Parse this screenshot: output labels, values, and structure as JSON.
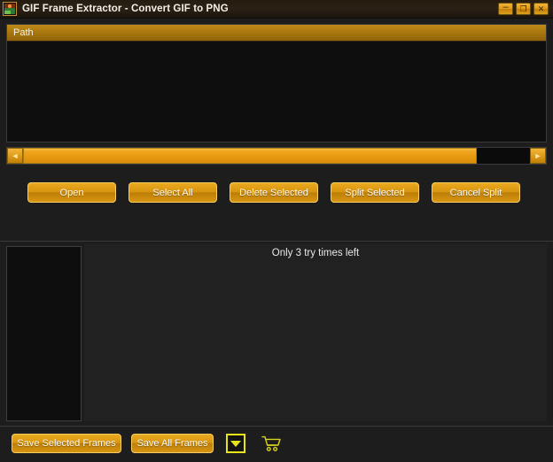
{
  "window": {
    "title": "GIF Frame Extractor - Convert GIF to PNG",
    "icon": "picture-icon",
    "controls": {
      "minimize": "–",
      "minimize_name": "minimize-button",
      "maximize": "❐",
      "maximize_name": "maximize-button",
      "close": "✕",
      "close_name": "close-button"
    }
  },
  "file_list": {
    "columns": [
      "Path"
    ],
    "rows": []
  },
  "scrollbar": {
    "left_arrow": "◄",
    "right_arrow": "►"
  },
  "actions": [
    {
      "label": "Open",
      "name": "open-button"
    },
    {
      "label": "Select All",
      "name": "select-all-button"
    },
    {
      "label": "Delete Selected",
      "name": "delete-selected-button"
    },
    {
      "label": "Split Selected",
      "name": "split-selected-button"
    },
    {
      "label": "Cancel Split",
      "name": "cancel-split-button"
    }
  ],
  "status": {
    "message": "Only 3 try times left"
  },
  "bottom_bar": {
    "save_selected": "Save Selected Frames",
    "save_all": "Save All Frames",
    "dropdown_icon": "chevron-down-icon",
    "cart_icon": "shopping-cart-icon"
  },
  "colors": {
    "accent": "#e09c18",
    "accent_light": "#f5cd62",
    "header_gold": "#a8760f",
    "highlight_yellow": "#e8e41a",
    "background": "#1d1d1d",
    "panel": "#0e0e0e",
    "title_text": "#f2efe8"
  }
}
